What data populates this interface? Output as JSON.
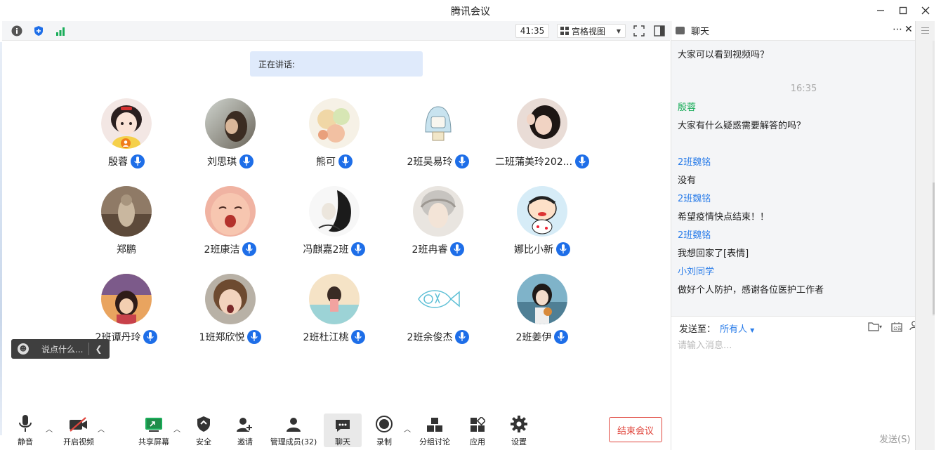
{
  "window": {
    "title": "腾讯会议",
    "controls": [
      "minimize",
      "maximize",
      "close"
    ]
  },
  "topbar": {
    "icons": [
      "info-icon",
      "shield-icon",
      "signal-icon"
    ],
    "timer": "41:35",
    "view_mode": "宫格视图",
    "right_icons": [
      "fullscreen-icon",
      "panel-layout-icon"
    ]
  },
  "speaking": {
    "label": "正在讲话:"
  },
  "participants": [
    {
      "name": "殷蓉",
      "mic": true,
      "host": true
    },
    {
      "name": "刘思琪",
      "mic": true
    },
    {
      "name": "熊可",
      "mic": true
    },
    {
      "name": "2班吴易玲",
      "mic": true
    },
    {
      "name": "二班蒲美玲202...",
      "mic": true
    },
    {
      "name": "郑鹏",
      "mic": false
    },
    {
      "name": "2班康洁",
      "mic": true
    },
    {
      "name": "冯麒嘉2班",
      "mic": true
    },
    {
      "name": "2班冉睿",
      "mic": true
    },
    {
      "name": "娜比小新",
      "mic": true
    },
    {
      "name": "2班谭丹玲",
      "mic": true
    },
    {
      "name": "1班郑欣悦",
      "mic": true
    },
    {
      "name": "2班杜江桃",
      "mic": true
    },
    {
      "name": "2班余俊杰",
      "mic": true
    },
    {
      "name": "2班姜伊",
      "mic": true
    }
  ],
  "chat_hint": {
    "placeholder": "说点什么..."
  },
  "bottombar": {
    "mute": "静音",
    "video": "开启视频",
    "share": "共享屏幕",
    "security": "安全",
    "invite": "邀请",
    "members": "管理成员(32)",
    "chat": "聊天",
    "record": "录制",
    "breakout": "分组讨论",
    "apps": "应用",
    "settings": "设置",
    "end_meeting": "结束会议"
  },
  "chat": {
    "title": "聊天",
    "messages": [
      {
        "type": "text",
        "text": "大家可以看到视频吗？"
      },
      {
        "type": "time",
        "text": "16:35"
      },
      {
        "type": "sender",
        "text": "殷蓉",
        "color": "#1aad5a"
      },
      {
        "type": "text",
        "text": "大家有什么疑惑需要解答的吗？"
      },
      {
        "type": "sender",
        "text": "2班魏铭",
        "color": "#2b7de9"
      },
      {
        "type": "text",
        "text": "没有"
      },
      {
        "type": "sender",
        "text": "2班魏铭",
        "color": "#2b7de9"
      },
      {
        "type": "text",
        "text": "希望疫情快点结束！！"
      },
      {
        "type": "sender",
        "text": "2班魏铭",
        "color": "#2b7de9"
      },
      {
        "type": "text",
        "text": "我想回家了[表情]"
      },
      {
        "type": "sender",
        "text": "小刘同学",
        "color": "#2b7de9"
      },
      {
        "type": "text",
        "text": "做好个人防护，感谢各位医护工作者"
      }
    ],
    "send_to_label": "发送至：",
    "send_to_target": "所有人",
    "input_placeholder": "请输入消息...",
    "send_button": "发送(S)",
    "notice_icon_label": "公告"
  }
}
